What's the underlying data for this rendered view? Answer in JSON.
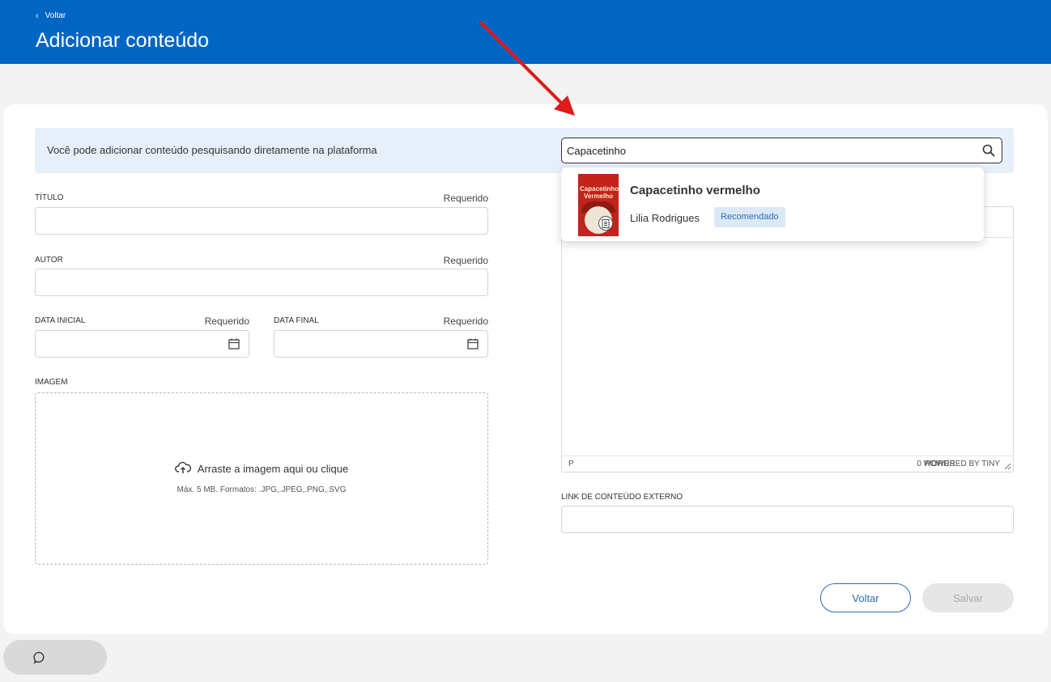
{
  "header": {
    "back_label": "Voltar",
    "title": "Adicionar conteúdo",
    "color": "#0066c4"
  },
  "search": {
    "banner_text": "Você pode adicionar conteúdo pesquisando diretamente na plataforma",
    "value": "Capacetinho",
    "placeholder": "",
    "icon": "search-icon"
  },
  "search_results": [
    {
      "title": "Capacetinho vermelho",
      "author": "Lilia Rodrigues",
      "badge": "Recomendado",
      "cover_text": "Capacetinho Vermelho",
      "type_icon": "document-icon"
    }
  ],
  "form": {
    "titulo": {
      "label": "TÍTULO",
      "required": "Requerido",
      "value": ""
    },
    "autor": {
      "label": "AUTOR",
      "required": "Requerido",
      "value": ""
    },
    "data_inicial": {
      "label": "DATA INICIAL",
      "required": "Requerido",
      "value": "",
      "icon": "calendar-icon"
    },
    "data_final": {
      "label": "DATA FINAL",
      "required": "Requerido",
      "value": "",
      "icon": "calendar-icon"
    },
    "imagem": {
      "label": "IMAGEM",
      "drop_text": "Arraste a imagem aqui ou clique",
      "hint": "Máx. 5 MB. Formatos: .JPG,.JPEG,.PNG,.SVG",
      "icon": "cloud-upload-icon"
    },
    "editor": {
      "status_path": "P",
      "word_count": "0 WORDS",
      "powered_by": "POWERED BY TINY"
    },
    "link_externo": {
      "label": "LINK DE CONTEÚDO EXTERNO",
      "value": ""
    }
  },
  "actions": {
    "back_label": "Voltar",
    "save_label": "Salvar"
  },
  "chat": {
    "icon": "chat-bubble-icon"
  },
  "colors": {
    "primary": "#2a6cb3",
    "banner": "#e7f0fa",
    "annotation_arrow": "#e01b1b"
  }
}
